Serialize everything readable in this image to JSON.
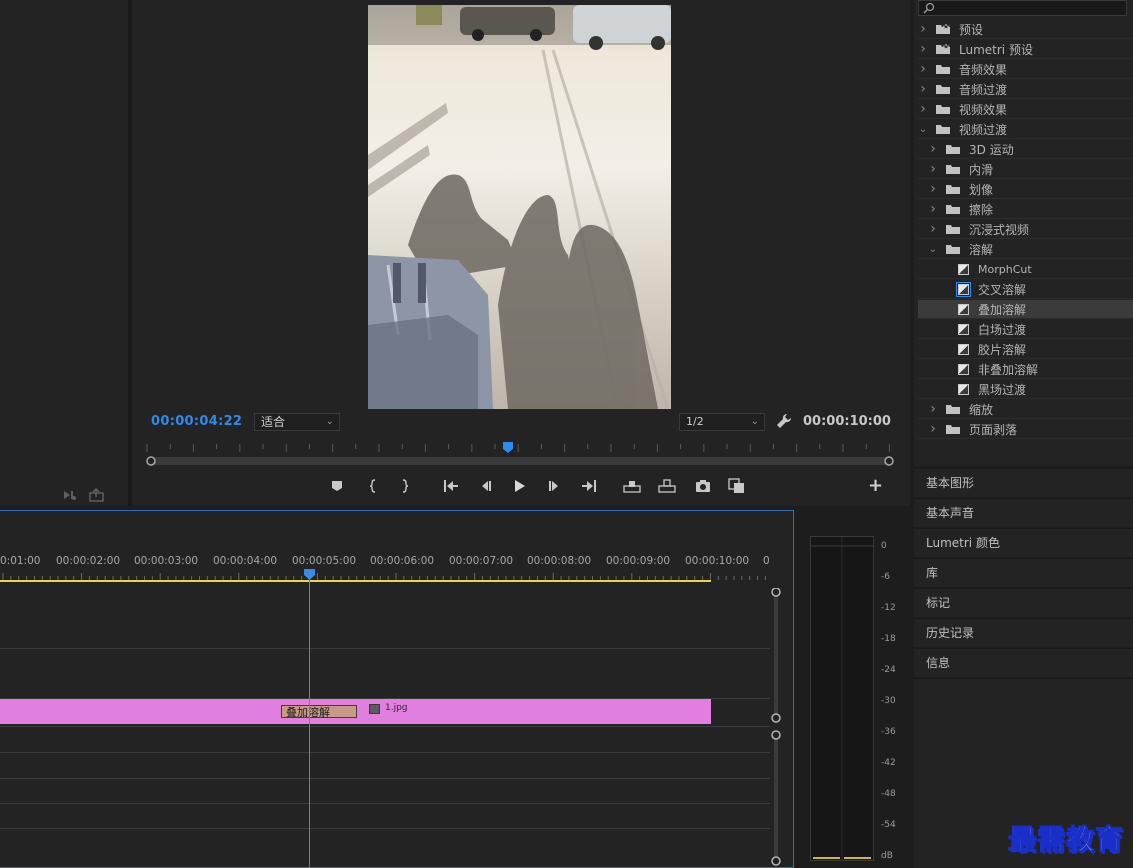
{
  "monitor": {
    "current_timecode": "00:00:04:22",
    "fit_label": "适合",
    "resolution_label": "1/2",
    "duration_timecode": "00:00:10:00"
  },
  "effects_tree": [
    {
      "label": "预设",
      "level": 0,
      "expanded": false,
      "kind": "preset-folder"
    },
    {
      "label": "Lumetri 预设",
      "level": 0,
      "expanded": false,
      "kind": "preset-folder"
    },
    {
      "label": "音频效果",
      "level": 0,
      "expanded": false,
      "kind": "folder"
    },
    {
      "label": "音频过渡",
      "level": 0,
      "expanded": false,
      "kind": "folder"
    },
    {
      "label": "视频效果",
      "level": 0,
      "expanded": false,
      "kind": "folder"
    },
    {
      "label": "视频过渡",
      "level": 0,
      "expanded": true,
      "kind": "folder"
    },
    {
      "label": "3D 运动",
      "level": 1,
      "expanded": false,
      "kind": "folder"
    },
    {
      "label": "内滑",
      "level": 1,
      "expanded": false,
      "kind": "folder"
    },
    {
      "label": "划像",
      "level": 1,
      "expanded": false,
      "kind": "folder"
    },
    {
      "label": "擦除",
      "level": 1,
      "expanded": false,
      "kind": "folder"
    },
    {
      "label": "沉浸式视频",
      "level": 1,
      "expanded": false,
      "kind": "folder"
    },
    {
      "label": "溶解",
      "level": 1,
      "expanded": true,
      "kind": "folder"
    },
    {
      "label": "MorphCut",
      "level": 2,
      "kind": "effect"
    },
    {
      "label": "交叉溶解",
      "level": 2,
      "kind": "effect",
      "focused": true
    },
    {
      "label": "叠加溶解",
      "level": 2,
      "kind": "effect",
      "selected": true
    },
    {
      "label": "白场过渡",
      "level": 2,
      "kind": "effect"
    },
    {
      "label": "胶片溶解",
      "level": 2,
      "kind": "effect"
    },
    {
      "label": "非叠加溶解",
      "level": 2,
      "kind": "effect"
    },
    {
      "label": "黑场过渡",
      "level": 2,
      "kind": "effect"
    },
    {
      "label": "缩放",
      "level": 1,
      "expanded": false,
      "kind": "folder"
    },
    {
      "label": "页面剥落",
      "level": 1,
      "expanded": false,
      "kind": "folder"
    }
  ],
  "side_panels": [
    "基本图形",
    "基本声音",
    "Lumetri 颜色",
    "库",
    "标记",
    "历史记录",
    "信息"
  ],
  "timeline": {
    "ruler_labels": [
      "0:01:00",
      "00:00:02:00",
      "00:00:03:00",
      "00:00:04:00",
      "00:00:05:00",
      "00:00:06:00",
      "00:00:07:00",
      "00:00:08:00",
      "00:00:09:00",
      "00:00:10:00",
      "0"
    ],
    "transition_label": "叠加溶解",
    "clip_label": "1.jpg"
  },
  "audio_meter": {
    "db_labels": [
      "0",
      "-6",
      "-12",
      "-18",
      "-24",
      "-30",
      "-36",
      "-42",
      "-48",
      "-54",
      "dB"
    ]
  },
  "watermark": "最需教育",
  "colors": {
    "accent_blue": "#2d8ceb",
    "clip_pink": "#e17fe0",
    "transition": "#c79a84",
    "work_area_yellow": "#e6d64a"
  }
}
